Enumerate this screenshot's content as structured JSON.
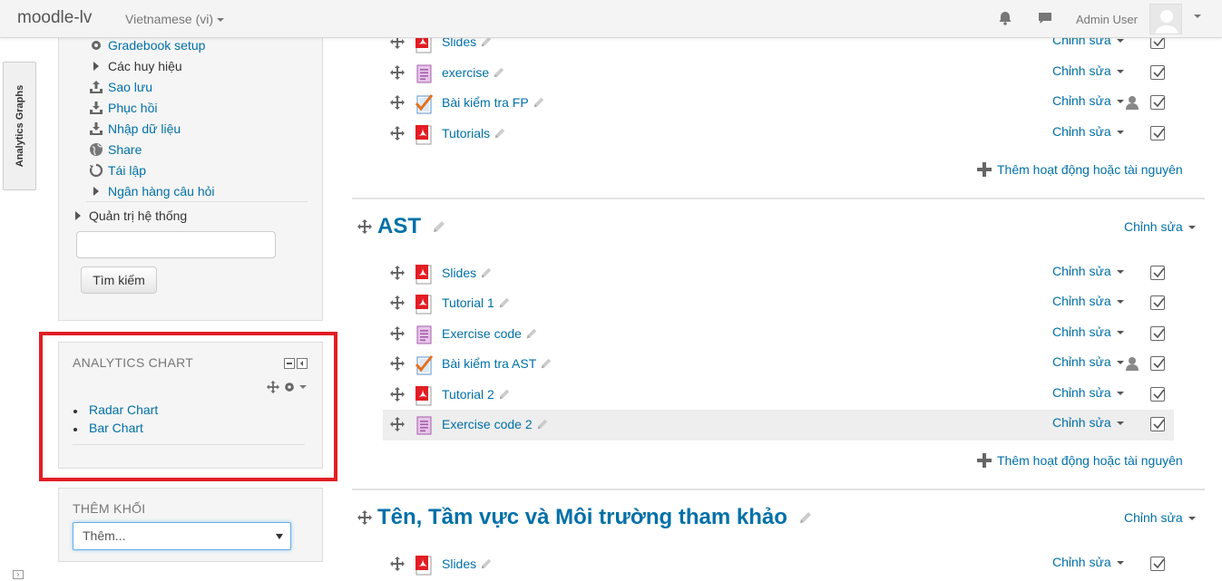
{
  "navbar": {
    "brand": "moodle-lv",
    "language": "Vietnamese (vi)",
    "username": "Admin User",
    "icons": [
      "notifications-icon",
      "messages-icon",
      "avatar"
    ]
  },
  "dock": {
    "tab_label": "Analytics Graphs"
  },
  "admin_block": {
    "items": [
      {
        "label": "Gradebook setup",
        "icon": "gear-icon",
        "link": true
      },
      {
        "label": "Các huy hiệu",
        "icon": "triangle-right-icon",
        "link": false
      },
      {
        "label": "Sao lưu",
        "icon": "upload-icon",
        "link": true
      },
      {
        "label": "Phục hồi",
        "icon": "download-icon",
        "link": true
      },
      {
        "label": "Nhập dữ liệu",
        "icon": "import-icon",
        "link": true
      },
      {
        "label": "Share",
        "icon": "globe-icon",
        "link": true
      },
      {
        "label": "Tái lập",
        "icon": "reset-icon",
        "link": true
      },
      {
        "label": "Ngân hàng câu hỏi",
        "icon": "triangle-right-icon",
        "link": true
      }
    ],
    "system_admin": "Quản trị hệ thống",
    "search_button": "Tìm kiếm",
    "search_value": ""
  },
  "chart_block": {
    "title": "ANALYTICS CHART",
    "links": [
      "Radar Chart",
      "Bar Chart"
    ]
  },
  "add_block": {
    "title": "THÊM KHỐI",
    "select_value": "Thêm..."
  },
  "labels": {
    "edit": "Chỉnh sửa",
    "add_activity": "Thêm hoạt động hoặc tài nguyên"
  },
  "sections": [
    {
      "title": "",
      "activities": [
        {
          "name": "Slides",
          "type": "pdf",
          "restricted": false
        },
        {
          "name": "exercise",
          "type": "page",
          "restricted": false
        },
        {
          "name": "Bài kiểm tra FP",
          "type": "quiz",
          "restricted": true
        },
        {
          "name": "Tutorials",
          "type": "pdf",
          "restricted": false
        }
      ]
    },
    {
      "title": "AST",
      "activities": [
        {
          "name": "Slides",
          "type": "pdf",
          "restricted": false
        },
        {
          "name": "Tutorial 1",
          "type": "pdf",
          "restricted": false
        },
        {
          "name": "Exercise code",
          "type": "page",
          "restricted": false
        },
        {
          "name": "Bài kiểm tra AST",
          "type": "quiz",
          "restricted": true
        },
        {
          "name": "Tutorial 2",
          "type": "pdf",
          "restricted": false
        },
        {
          "name": "Exercise code 2",
          "type": "page",
          "restricted": false,
          "highlighted": true
        }
      ]
    },
    {
      "title": "Tên, Tầm vực và Môi trường tham khảo",
      "activities": [
        {
          "name": "Slides",
          "type": "pdf",
          "restricted": false
        }
      ]
    }
  ],
  "colors": {
    "link": "#0070a8",
    "highlight_frame": "#e21d24"
  }
}
